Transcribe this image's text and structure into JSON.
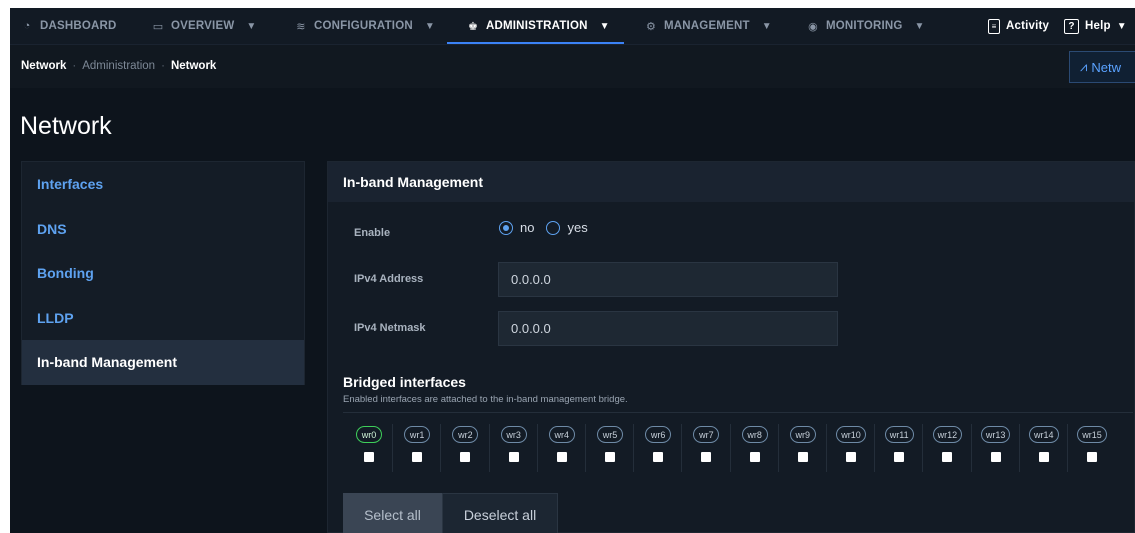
{
  "nav": {
    "items": [
      {
        "label": "DASHBOARD",
        "icon": "gauge-icon"
      },
      {
        "label": "OVERVIEW",
        "icon": "monitor-icon"
      },
      {
        "label": "CONFIGURATION",
        "icon": "sliders-icon"
      },
      {
        "label": "ADMINISTRATION",
        "icon": "users-icon"
      },
      {
        "label": "MANAGEMENT",
        "icon": "gear-icon"
      },
      {
        "label": "MONITORING",
        "icon": "eye-icon"
      }
    ],
    "active": "ADMINISTRATION",
    "activity_label": "Activity",
    "help_label": "Help"
  },
  "breadcrumb": {
    "items": [
      "Network",
      "Administration",
      "Network"
    ],
    "action_label": "Netw"
  },
  "page": {
    "title": "Network"
  },
  "sidebar": {
    "items": [
      {
        "label": "Interfaces"
      },
      {
        "label": "DNS"
      },
      {
        "label": "Bonding"
      },
      {
        "label": "LLDP"
      },
      {
        "label": "In-band Management"
      }
    ],
    "active": "In-band Management"
  },
  "panel": {
    "title": "In-band Management",
    "enable": {
      "label": "Enable",
      "options": [
        "no",
        "yes"
      ],
      "selected": "no"
    },
    "ipv4_address": {
      "label": "IPv4 Address",
      "value": "0.0.0.0"
    },
    "ipv4_netmask": {
      "label": "IPv4 Netmask",
      "value": "0.0.0.0"
    },
    "bridged": {
      "title": "Bridged interfaces",
      "subtitle": "Enabled interfaces are attached to the in-band management bridge.",
      "interfaces": [
        "wr0",
        "wr1",
        "wr2",
        "wr3",
        "wr4",
        "wr5",
        "wr6",
        "wr7",
        "wr8",
        "wr9",
        "wr10",
        "wr11",
        "wr12",
        "wr13",
        "wr14",
        "wr15"
      ],
      "highlighted": "wr0"
    },
    "buttons": {
      "select_all": "Select all",
      "deselect_all": "Deselect all"
    }
  },
  "colors": {
    "accent": "#5ea2f0",
    "active_iface": "#3ecf5a",
    "background": "#0d141c"
  }
}
